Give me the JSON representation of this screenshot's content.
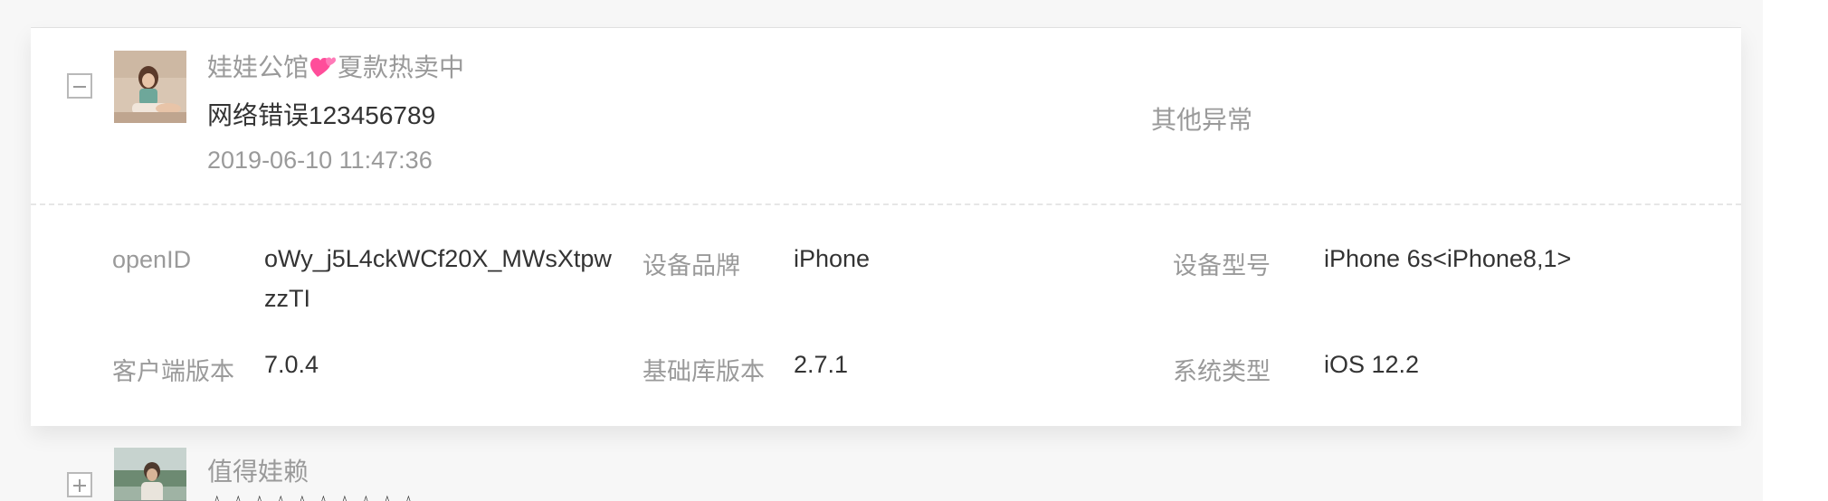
{
  "records": [
    {
      "toggle_state": "expanded",
      "shop_name": "娃娃公馆",
      "shop_suffix": "夏款热卖中",
      "shop_icon": "two-hearts-icon",
      "message": "网络错误123456789",
      "time": "2019-06-10 11:47:36",
      "error_type": "其他异常",
      "details": {
        "openid_label": "openID",
        "openid_value": "oWy_j5L4ckWCf20X_MWsXtpwzzTI",
        "brand_label": "设备品牌",
        "brand_value": "iPhone",
        "model_label": "设备型号",
        "model_value": "iPhone 6s<iPhone8,1>",
        "client_version_label": "客户端版本",
        "client_version_value": "7.0.4",
        "lib_version_label": "基础库版本",
        "lib_version_value": "2.7.1",
        "os_label": "系统类型",
        "os_value": "iOS 12.2"
      }
    },
    {
      "toggle_state": "collapsed",
      "shop_name": "值得娃赖",
      "message": "☆☆☆☆☆☆☆☆☆☆"
    }
  ],
  "colors": {
    "background": "#f7f7f7",
    "card": "#ffffff",
    "muted_text": "#9a9a9a",
    "primary_text": "#333333",
    "heart": "#ff4d9a"
  }
}
